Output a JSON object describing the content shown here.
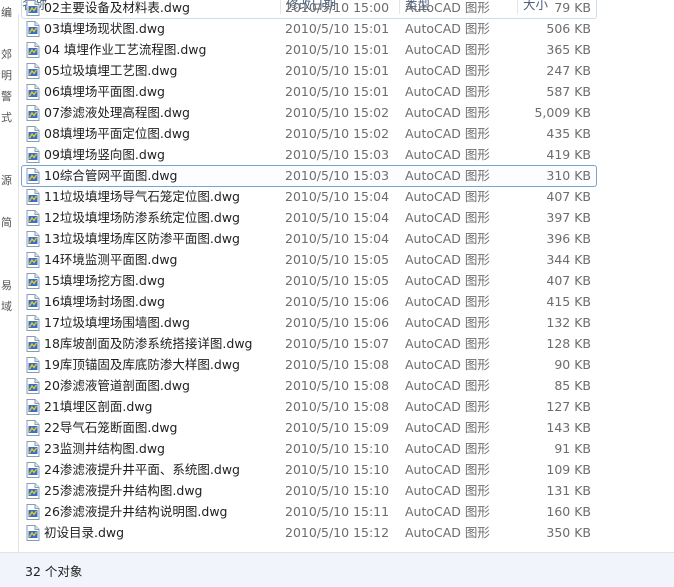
{
  "columns": {
    "name": "名称",
    "date": "修改日期",
    "type": "类型",
    "size": "大小"
  },
  "left_strip": [
    "编",
    "",
    "郊",
    "明",
    "警",
    "式",
    "",
    "",
    "源",
    "",
    "简",
    "",
    "",
    "易",
    "域",
    "",
    "",
    "",
    "",
    "",
    "",
    "",
    "",
    "",
    "",
    ""
  ],
  "files": [
    {
      "name": "02主要设备及材料表.dwg",
      "date": "2010/5/10 15:00",
      "type": "AutoCAD 图形",
      "size": "79 KB"
    },
    {
      "name": "03填埋场现状图.dwg",
      "date": "2010/5/10 15:01",
      "type": "AutoCAD 图形",
      "size": "506 KB"
    },
    {
      "name": "04 填埋作业工艺流程图.dwg",
      "date": "2010/5/10 15:01",
      "type": "AutoCAD 图形",
      "size": "365 KB"
    },
    {
      "name": "05垃圾填埋工艺图.dwg",
      "date": "2010/5/10 15:01",
      "type": "AutoCAD 图形",
      "size": "247 KB"
    },
    {
      "name": "06填埋场平面图.dwg",
      "date": "2010/5/10 15:01",
      "type": "AutoCAD 图形",
      "size": "587 KB"
    },
    {
      "name": "07渗滤液处理高程图.dwg",
      "date": "2010/5/10 15:02",
      "type": "AutoCAD 图形",
      "size": "5,009 KB"
    },
    {
      "name": "08填埋场平面定位图.dwg",
      "date": "2010/5/10 15:02",
      "type": "AutoCAD 图形",
      "size": "435 KB"
    },
    {
      "name": "09填埋场竖向图.dwg",
      "date": "2010/5/10 15:03",
      "type": "AutoCAD 图形",
      "size": "419 KB"
    },
    {
      "name": "10综合管网平面图.dwg",
      "date": "2010/5/10 15:03",
      "type": "AutoCAD 图形",
      "size": "310 KB"
    },
    {
      "name": "11垃圾填埋场导气石笼定位图.dwg",
      "date": "2010/5/10 15:04",
      "type": "AutoCAD 图形",
      "size": "407 KB"
    },
    {
      "name": "12垃圾填埋场防渗系统定位图.dwg",
      "date": "2010/5/10 15:04",
      "type": "AutoCAD 图形",
      "size": "397 KB"
    },
    {
      "name": "13垃圾填埋场库区防渗平面图.dwg",
      "date": "2010/5/10 15:04",
      "type": "AutoCAD 图形",
      "size": "396 KB"
    },
    {
      "name": "14环境监测平面图.dwg",
      "date": "2010/5/10 15:05",
      "type": "AutoCAD 图形",
      "size": "344 KB"
    },
    {
      "name": "15填埋场挖方图.dwg",
      "date": "2010/5/10 15:05",
      "type": "AutoCAD 图形",
      "size": "407 KB"
    },
    {
      "name": "16填埋场封场图.dwg",
      "date": "2010/5/10 15:06",
      "type": "AutoCAD 图形",
      "size": "415 KB"
    },
    {
      "name": "17垃圾填埋场围墙图.dwg",
      "date": "2010/5/10 15:06",
      "type": "AutoCAD 图形",
      "size": "132 KB"
    },
    {
      "name": "18库坡剖面及防渗系统搭接详图.dwg",
      "date": "2010/5/10 15:07",
      "type": "AutoCAD 图形",
      "size": "128 KB"
    },
    {
      "name": "19库顶锚固及库底防渗大样图.dwg",
      "date": "2010/5/10 15:08",
      "type": "AutoCAD 图形",
      "size": "90 KB"
    },
    {
      "name": "20渗滤液管道剖面图.dwg",
      "date": "2010/5/10 15:08",
      "type": "AutoCAD 图形",
      "size": "85 KB"
    },
    {
      "name": "21填埋区剖面.dwg",
      "date": "2010/5/10 15:08",
      "type": "AutoCAD 图形",
      "size": "127 KB"
    },
    {
      "name": "22导气石笼断面图.dwg",
      "date": "2010/5/10 15:09",
      "type": "AutoCAD 图形",
      "size": "143 KB"
    },
    {
      "name": "23监测井结构图.dwg",
      "date": "2010/5/10 15:10",
      "type": "AutoCAD 图形",
      "size": "91 KB"
    },
    {
      "name": "24渗滤液提升井平面、系统图.dwg",
      "date": "2010/5/10 15:10",
      "type": "AutoCAD 图形",
      "size": "109 KB"
    },
    {
      "name": "25渗滤液提升井结构图.dwg",
      "date": "2010/5/10 15:10",
      "type": "AutoCAD 图形",
      "size": "131 KB"
    },
    {
      "name": "26渗滤液提升井结构说明图.dwg",
      "date": "2010/5/10 15:11",
      "type": "AutoCAD 图形",
      "size": "160 KB"
    },
    {
      "name": "初设目录.dwg",
      "date": "2010/5/10 15:12",
      "type": "AutoCAD 图形",
      "size": "350 KB"
    }
  ],
  "selected_index": 8,
  "status": {
    "count_text": "32 个对象"
  },
  "colors": {
    "header_text": "#4c607a",
    "selection_border": "#7da2ce",
    "statusbar_bg": "#f1f5fb",
    "icon_accent": "#e6a21a"
  }
}
